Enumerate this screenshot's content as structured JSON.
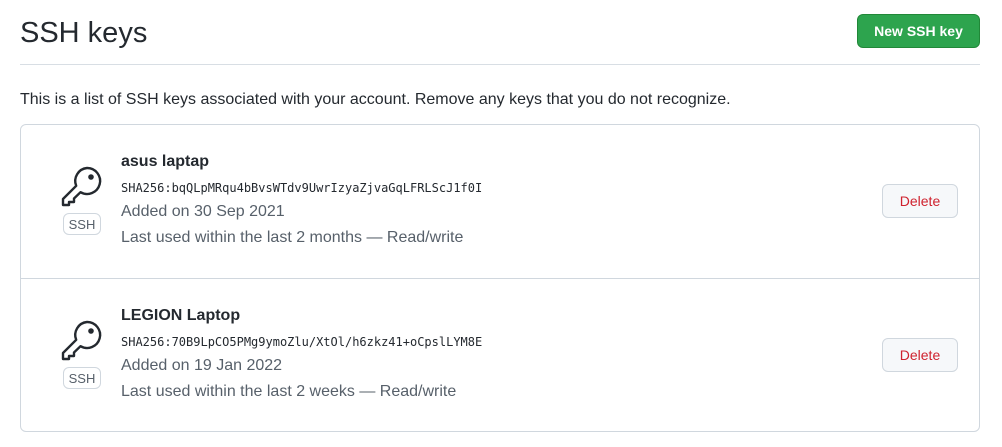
{
  "header": {
    "title": "SSH keys",
    "new_key_label": "New SSH key"
  },
  "intro": "This is a list of SSH keys associated with your account. Remove any keys that you do not recognize.",
  "keys": [
    {
      "title": "asus laptap",
      "fingerprint": "SHA256:bqQLpMRqu4bBvsWTdv9UwrIzyaZjvaGqLFRLScJ1f0I",
      "added": "Added on 30 Sep 2021",
      "used": "Last used within the last 2 months — Read/write",
      "badge": "SSH",
      "delete_label": "Delete",
      "icon": "key-icon"
    },
    {
      "title": "LEGION Laptop",
      "fingerprint": "SHA256:70B9LpCO5PMg9ymoZlu/XtOl/h6zkz41+oCpslLYM8E",
      "added": "Added on 19 Jan 2022",
      "used": "Last used within the last 2 weeks — Read/write",
      "badge": "SSH",
      "delete_label": "Delete",
      "icon": "key-icon"
    }
  ],
  "colors": {
    "primary_button": "#2da44e",
    "danger_text": "#cf222e",
    "muted_text": "#57606a",
    "border": "#d0d7de"
  }
}
